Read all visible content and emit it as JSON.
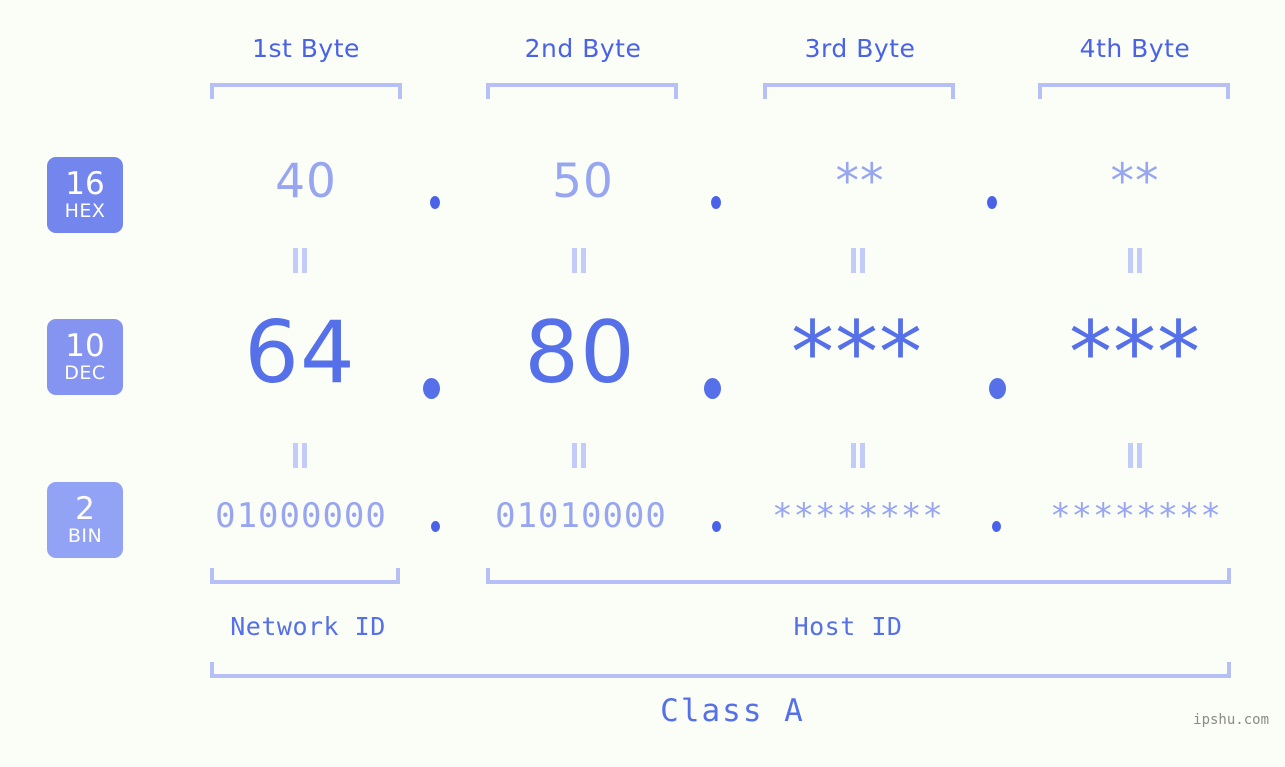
{
  "background_color": "#fbfdf7",
  "accent_colors": {
    "strong_blue": "#4a62e8",
    "mid_blue": "#5570e8",
    "light_blue": "#98a6f2",
    "bracket_blue": "#b6c0f7",
    "connector_blue": "#c3cbfa",
    "badge_hex": "#7386ee",
    "badge_dec": "#8494f0",
    "badge_bin": "#92a3f5"
  },
  "byte_headers": [
    {
      "label": "1st Byte"
    },
    {
      "label": "2nd Byte"
    },
    {
      "label": "3rd Byte"
    },
    {
      "label": "4th Byte"
    }
  ],
  "bases": [
    {
      "number": "16",
      "name": "HEX"
    },
    {
      "number": "10",
      "name": "DEC"
    },
    {
      "number": "2",
      "name": "BIN"
    }
  ],
  "rows": {
    "hex": {
      "base_number": "16",
      "base_name": "HEX",
      "values": [
        "40",
        "50",
        "**",
        "**"
      ],
      "separator": "."
    },
    "dec": {
      "base_number": "10",
      "base_name": "DEC",
      "values": [
        "64",
        "80",
        "***",
        "***"
      ],
      "separator": "."
    },
    "bin": {
      "base_number": "2",
      "base_name": "BIN",
      "values": [
        "01000000",
        "01010000",
        "********",
        "********"
      ],
      "separator": "."
    }
  },
  "connectors": {
    "symbol": "equals-double-bar",
    "count_per_row": 4
  },
  "id_sections": [
    {
      "label": "Network ID"
    },
    {
      "label": "Host ID"
    }
  ],
  "class_label": "Class A",
  "watermark": "ipshu.com"
}
